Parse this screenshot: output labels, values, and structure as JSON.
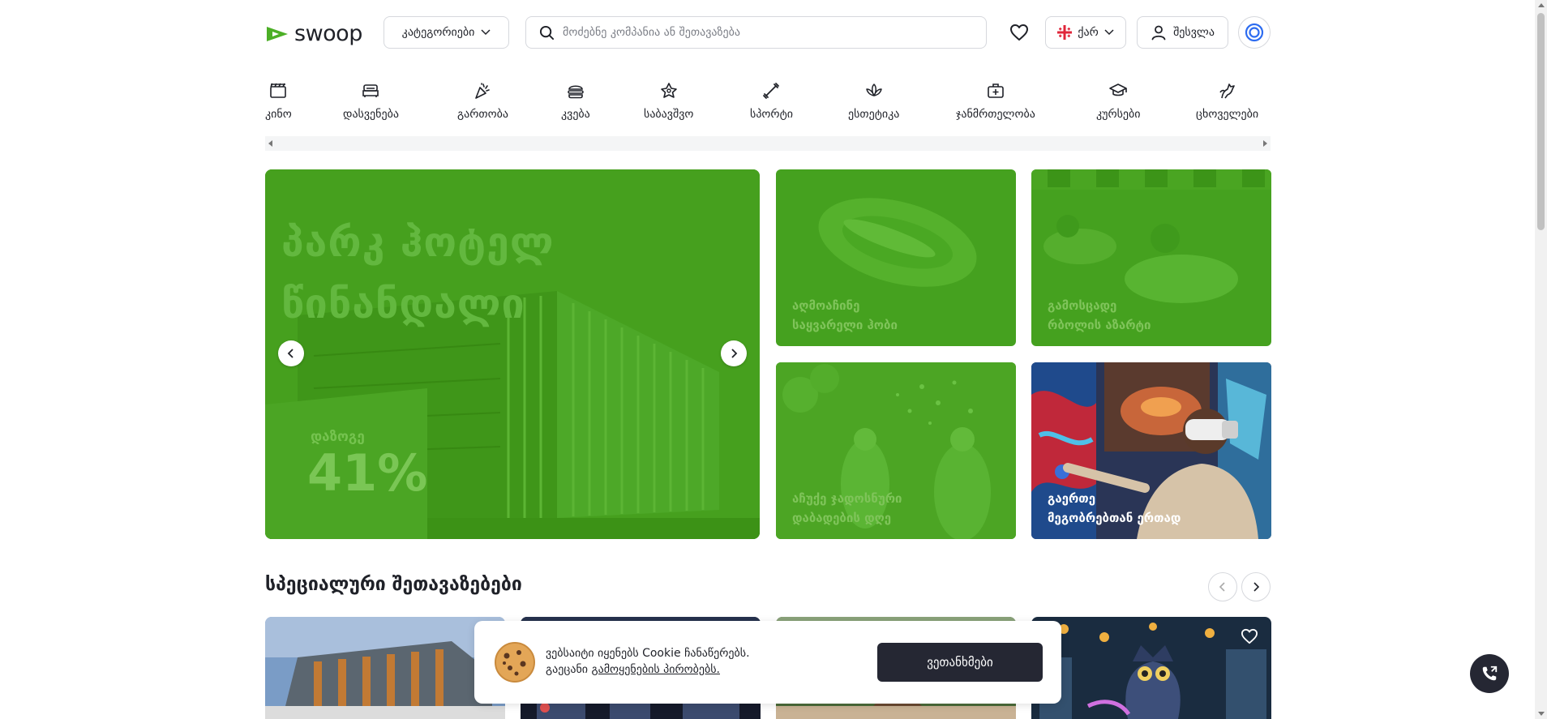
{
  "header": {
    "logo_text": "swoop",
    "categories_button": "კატეგორიები",
    "search_placeholder": "მოძებნე კომპანია ან შეთავაზება",
    "language": "ქარ",
    "login": "შესვლა"
  },
  "categories": [
    {
      "label": "კინო",
      "icon": "cinema-icon"
    },
    {
      "label": "დასვენება",
      "icon": "bed-icon"
    },
    {
      "label": "გართობა",
      "icon": "party-icon"
    },
    {
      "label": "კვება",
      "icon": "burger-icon"
    },
    {
      "label": "საბავშვო",
      "icon": "kids-icon"
    },
    {
      "label": "სპორტი",
      "icon": "dumbbell-icon"
    },
    {
      "label": "ესთეტიკა",
      "icon": "lotus-icon"
    },
    {
      "label": "ჯანმრთელობა",
      "icon": "medkit-icon"
    },
    {
      "label": "კურსები",
      "icon": "graduation-cap-icon"
    },
    {
      "label": "ცხოველები",
      "icon": "animal-icon"
    }
  ],
  "hero": {
    "title_line1": "პარკ ჰოტელ",
    "title_line2": "წინანდალი",
    "discount_label": "დაზოგე",
    "discount_value": "41%"
  },
  "tiles": [
    {
      "line1": "აღმოაჩინე",
      "line2": "საყვარელი ჰობი"
    },
    {
      "line1": "გამოსცადე",
      "line2": "რბოლის აზარტი"
    },
    {
      "line1": "აჩუქე ჯადოსნური",
      "line2": "დაბადების დღე"
    },
    {
      "line1": "გაერთე",
      "line2": "მეგობრებთან ერთად"
    }
  ],
  "special_offers": {
    "title": "სპეციალური შეთავაზებები"
  },
  "cookie": {
    "line1": "ვებსაიტი იყენებს Cookie ჩანაწერებს.",
    "line2_prefix": "გაეცანი ",
    "line2_link": "გამოყენების პირობებს.",
    "accept": "ვეთანხმები"
  },
  "colors": {
    "brand_green": "#45a11f",
    "dark_button": "#252733"
  }
}
